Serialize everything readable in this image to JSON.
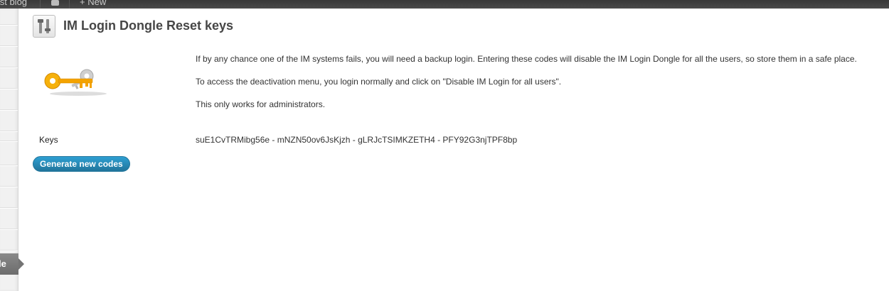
{
  "adminbar": {
    "site_name": "Test blog",
    "new_label": "New",
    "comments_icon": "comment-bubble-icon",
    "new_icon": "plus-icon"
  },
  "sidebar": {
    "current_item_label": "le"
  },
  "page": {
    "title": "IM Login Dongle Reset keys",
    "title_icon": "tools-icon",
    "image_icon": "keys-icon",
    "paragraphs": [
      "If by any chance one of the IM systems fails, you will need a backup login. Entering these codes will disable the IM Login Dongle for all the users, so store them in a safe place.",
      "To access the deactivation menu, you login normally and click on \"Disable IM Login for all users\".",
      "This only works for administrators."
    ],
    "keys_label": "Keys",
    "keys_value": "suE1CvTRMibg56e - mNZN50ov6JsKjzh - gLRJcTSIMKZETH4 - PFY92G3njTPF8bp",
    "generate_button": "Generate new codes"
  },
  "colors": {
    "adminbar_bg": "#464646",
    "button_blue": "#21759b",
    "key_orange": "#f4a300"
  }
}
